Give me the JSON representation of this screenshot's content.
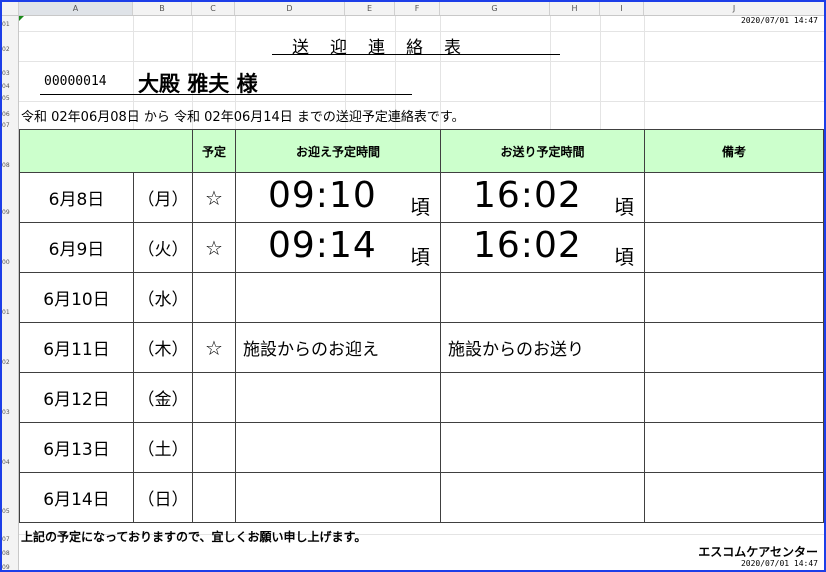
{
  "spreadsheet": {
    "columns": [
      "A",
      "B",
      "C",
      "D",
      "E",
      "F",
      "G",
      "H",
      "I",
      "J"
    ],
    "rows": [
      "01",
      "02",
      "03",
      "04",
      "05",
      "06",
      "07",
      "08",
      "09",
      "00",
      "01",
      "02",
      "03",
      "04",
      "05",
      "07",
      "08",
      "09"
    ]
  },
  "header": {
    "timestamp": "2020/07/01 14:47",
    "title": "送　迎　連　絡　表",
    "client_id": "00000014",
    "client_name": "大殿 雅夫 様",
    "period_text": "令和 02年06月08日 から 令和 02年06月14日 までの送迎予定連絡表です。"
  },
  "table": {
    "headers": {
      "scheduled": "予定",
      "pickup": "お迎え予定時間",
      "dropoff": "お送り予定時間",
      "remarks": "備考"
    },
    "rows": [
      {
        "date": "6月8日",
        "dow": "（月）",
        "star": "☆",
        "pickup": "09:10",
        "pickup_suffix": "頃",
        "dropoff": "16:02",
        "dropoff_suffix": "頃",
        "pickup_note": "",
        "dropoff_note": "",
        "remarks": ""
      },
      {
        "date": "6月9日",
        "dow": "（火）",
        "star": "☆",
        "pickup": "09:14",
        "pickup_suffix": "頃",
        "dropoff": "16:02",
        "dropoff_suffix": "頃",
        "pickup_note": "",
        "dropoff_note": "",
        "remarks": ""
      },
      {
        "date": "6月10日",
        "dow": "（水）",
        "star": "",
        "pickup": "",
        "pickup_suffix": "",
        "dropoff": "",
        "dropoff_suffix": "",
        "pickup_note": "",
        "dropoff_note": "",
        "remarks": ""
      },
      {
        "date": "6月11日",
        "dow": "（木）",
        "star": "☆",
        "pickup": "",
        "pickup_suffix": "",
        "dropoff": "",
        "dropoff_suffix": "",
        "pickup_note": "施設からのお迎え",
        "dropoff_note": "施設からのお送り",
        "remarks": ""
      },
      {
        "date": "6月12日",
        "dow": "（金）",
        "star": "",
        "pickup": "",
        "pickup_suffix": "",
        "dropoff": "",
        "dropoff_suffix": "",
        "pickup_note": "",
        "dropoff_note": "",
        "remarks": ""
      },
      {
        "date": "6月13日",
        "dow": "（土）",
        "star": "",
        "pickup": "",
        "pickup_suffix": "",
        "dropoff": "",
        "dropoff_suffix": "",
        "pickup_note": "",
        "dropoff_note": "",
        "remarks": ""
      },
      {
        "date": "6月14日",
        "dow": "（日）",
        "star": "",
        "pickup": "",
        "pickup_suffix": "",
        "dropoff": "",
        "dropoff_suffix": "",
        "pickup_note": "",
        "dropoff_note": "",
        "remarks": ""
      }
    ]
  },
  "footer": {
    "message": "上記の予定になっておりますので、宜しくお願い申し上げます。",
    "company": "エスコムケアセンター",
    "timestamp": "2020/07/01 14:47"
  },
  "colors": {
    "frame_border": "#1c3ee8",
    "header_fill": "#ccffcc"
  }
}
